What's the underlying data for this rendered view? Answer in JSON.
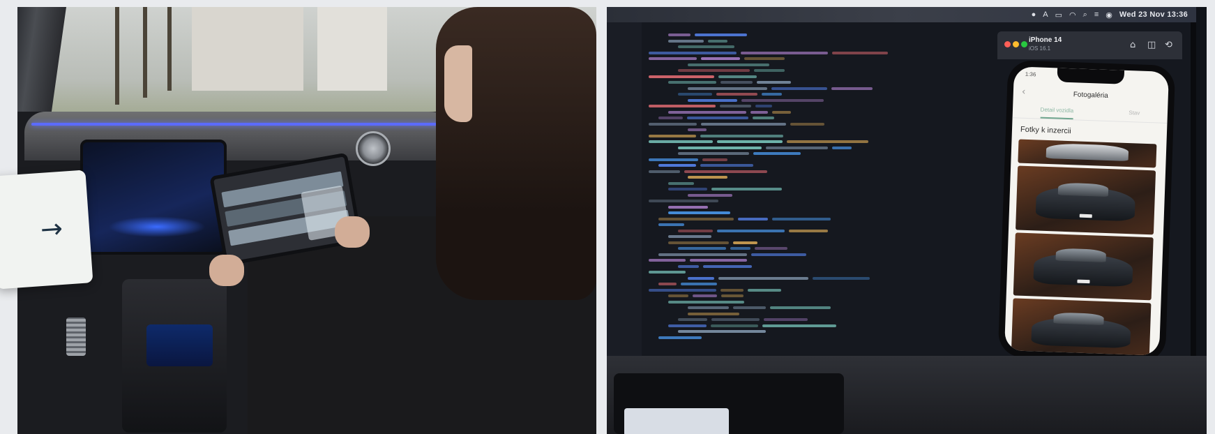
{
  "overlay": {
    "next_arrow": "→"
  },
  "mac_menubar": {
    "clock": "Wed 23 Nov  13:36",
    "icons": [
      "app-icon",
      "a-icon",
      "battery-icon",
      "wifi-icon",
      "search-icon",
      "control-center-icon",
      "siri-icon"
    ]
  },
  "simulator": {
    "device_name": "iPhone 14",
    "os_version": "iOS 16.1",
    "toolbar_icons": [
      "home-icon",
      "screenshot-icon",
      "rotate-icon"
    ]
  },
  "phone_app": {
    "status_time": "1:36",
    "back_glyph": "‹",
    "title": "Fotogaléria",
    "tabs": [
      {
        "label": "Detail vozidla",
        "active": true
      },
      {
        "label": "Stav",
        "active": false
      }
    ],
    "section_heading": "Fotky k inzercii",
    "accent_color": "#6fa58e"
  }
}
